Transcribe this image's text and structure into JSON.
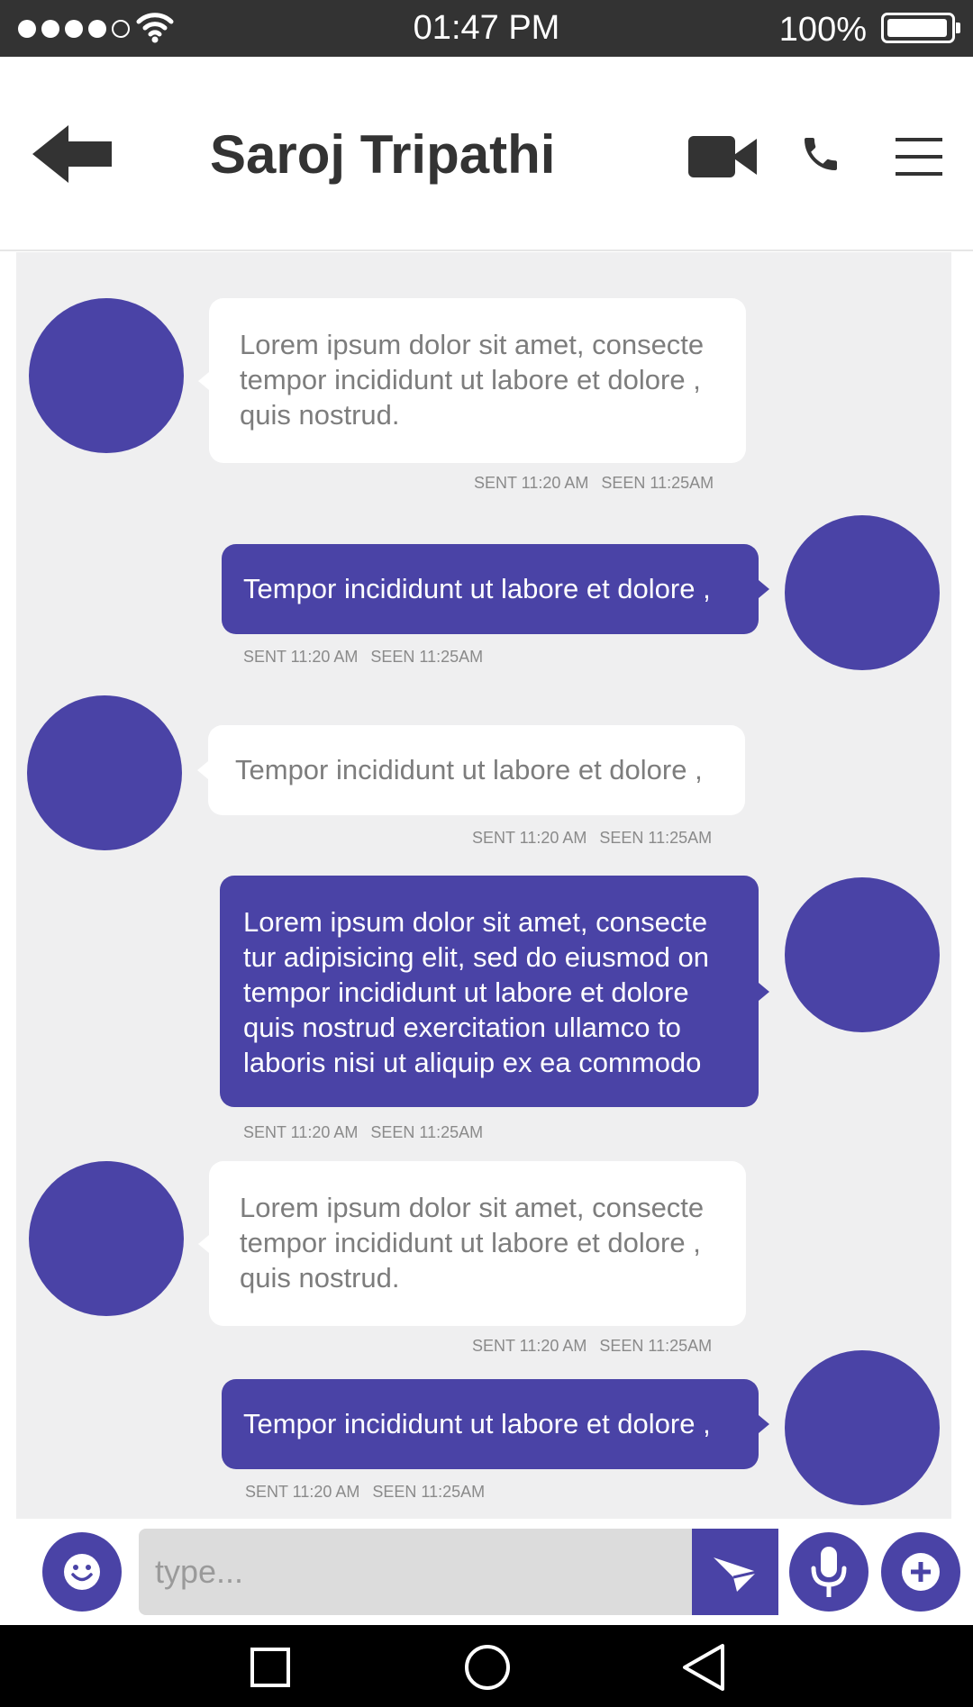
{
  "status_bar": {
    "time": "01:47 PM",
    "battery": "100%",
    "signal_bars_filled": 4,
    "signal_bars_total": 5,
    "icons": [
      "signal-dots-icon",
      "wifi-icon",
      "battery-icon"
    ]
  },
  "header": {
    "contact_name": "Saroj Tripathi",
    "icons": [
      "back-arrow-icon",
      "video-camera-icon",
      "phone-icon",
      "hamburger-menu-icon"
    ]
  },
  "messages": [
    {
      "direction": "in",
      "text": "Lorem ipsum dolor sit amet, consecte tempor incididunt ut labore et dolore , quis nostrud.",
      "sent": "SENT 11:20 AM",
      "seen": "SEEN 11:25AM"
    },
    {
      "direction": "out",
      "text": "Tempor incididunt ut labore et dolore ,",
      "sent": "SENT 11:20 AM",
      "seen": "SEEN 11:25AM"
    },
    {
      "direction": "in",
      "text": "Tempor incididunt ut labore et dolore ,",
      "sent": "SENT 11:20 AM",
      "seen": "SEEN 11:25AM"
    },
    {
      "direction": "out",
      "text": "Lorem ipsum dolor sit amet, consecte tur adipisicing elit, sed do eiusmod on tempor incididunt ut labore et dolore quis nostrud exercitation ullamco to laboris nisi ut aliquip ex ea commodo",
      "sent": "SENT 11:20 AM",
      "seen": "SEEN 11:25AM"
    },
    {
      "direction": "in",
      "text": "Lorem ipsum dolor sit amet, consecte tempor incididunt ut labore et dolore , quis nostrud.",
      "sent": "SENT 11:20 AM",
      "seen": "SEEN 11:25AM"
    },
    {
      "direction": "out",
      "text": "Tempor incididunt ut labore et dolore ,",
      "sent": "SENT 11:20 AM",
      "seen": "SEEN 11:25AM"
    }
  ],
  "composer": {
    "placeholder": "type...",
    "icons": [
      "emoji-icon",
      "send-icon",
      "microphone-icon",
      "add-icon"
    ]
  },
  "nav_bar": {
    "icons": [
      "recent-apps-icon",
      "home-icon",
      "back-icon"
    ]
  },
  "colors": {
    "accent": "#4a43a6",
    "status_bar": "#333333",
    "chat_background": "#efeff0",
    "incoming_bubble": "#ffffff",
    "incoming_text": "#7d7d7d",
    "meta_text": "#8a8a8a",
    "input_background": "#dcdcdc"
  }
}
